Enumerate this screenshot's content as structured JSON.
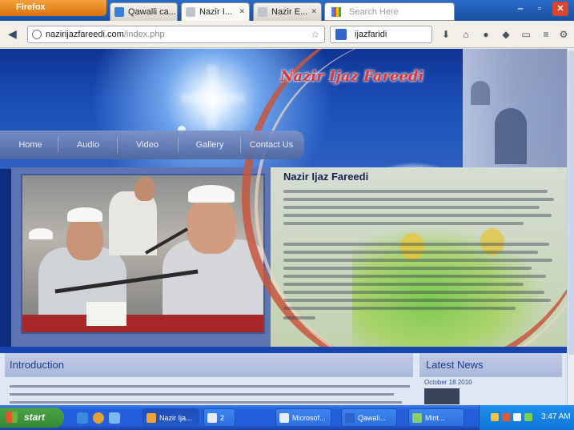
{
  "browser": {
    "app_button": "Firefox",
    "tabs": [
      {
        "label": "Qawalli ca...",
        "active": false
      },
      {
        "label": "Nazir I...",
        "active": true
      },
      {
        "label": "Nazir E...",
        "active": false
      }
    ],
    "search_tab_placeholder": "Search Here",
    "url_host": "nazirijazfareedi.com",
    "url_path": "/index.php",
    "search_query": "ijazfaridi"
  },
  "site": {
    "title": "Nazir Ijaz Fareedi",
    "menu": [
      "Home",
      "Audio",
      "Video",
      "Gallery",
      "Contact Us"
    ],
    "panel_title": "Nazir Ijaz Fareedi",
    "intro_heading": "Introduction",
    "news_heading": "Latest News",
    "news_date": "October 18 2010"
  },
  "taskbar": {
    "start_label": "start",
    "tasks": [
      "Nazir Ija...",
      "2",
      "Microsof...",
      "Qawali...",
      "Mint..."
    ],
    "clock": "3:47 AM"
  },
  "colors": {
    "accent": "#1846b0",
    "menu": "#52689f",
    "title": "#d9363a"
  }
}
